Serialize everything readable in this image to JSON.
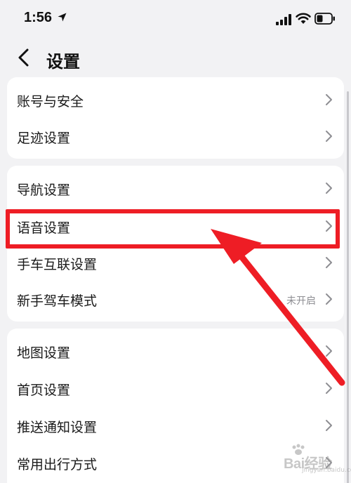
{
  "status_bar": {
    "time": "1:56"
  },
  "header": {
    "title": "设置"
  },
  "cards": [
    {
      "items": [
        {
          "label": "账号与安全"
        },
        {
          "label": "足迹设置"
        }
      ]
    },
    {
      "items": [
        {
          "label": "导航设置"
        },
        {
          "label": "语音设置"
        },
        {
          "label": "手车互联设置"
        },
        {
          "label": "新手驾车模式",
          "value": "未开启"
        }
      ]
    },
    {
      "items": [
        {
          "label": "地图设置"
        },
        {
          "label": "首页设置"
        },
        {
          "label": "推送通知设置"
        },
        {
          "label": "常用出行方式"
        }
      ]
    }
  ],
  "annotation": {
    "highlight_color": "#ee1d25"
  },
  "watermark": {
    "text": "Bai经验",
    "sub": "jingyan.baidu.com"
  },
  "icons": [
    "location-arrow-icon",
    "signal-icon",
    "wifi-icon",
    "battery-icon",
    "back-chevron-icon",
    "chevron-right-icon",
    "paw-icon"
  ]
}
